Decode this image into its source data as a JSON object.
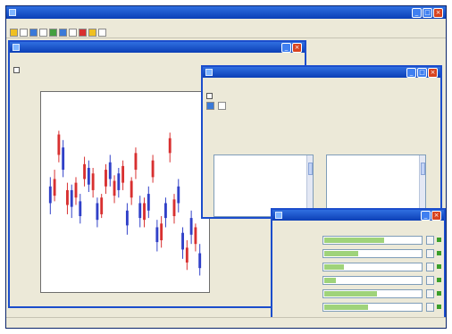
{
  "app": {
    "title": ""
  },
  "menu": {
    "items": [
      "",
      "",
      "",
      "",
      "",
      "",
      "",
      ""
    ]
  },
  "status": {
    "cells": [
      "",
      "",
      ""
    ]
  },
  "chart_window": {
    "title": "",
    "logo": "",
    "field_label": "",
    "option_label": ""
  },
  "chart_data": {
    "type": "candlestick",
    "grid": false,
    "bars": [
      {
        "o": 0.53,
        "c": 0.44,
        "h": 0.58,
        "l": 0.38
      },
      {
        "o": 0.48,
        "c": 0.57,
        "h": 0.62,
        "l": 0.45
      },
      {
        "o": 0.7,
        "c": 0.81,
        "h": 0.83,
        "l": 0.66
      },
      {
        "o": 0.74,
        "c": 0.62,
        "h": 0.78,
        "l": 0.58
      },
      {
        "o": 0.43,
        "c": 0.51,
        "h": 0.55,
        "l": 0.38
      },
      {
        "o": 0.51,
        "c": 0.42,
        "h": 0.54,
        "l": 0.36
      },
      {
        "o": 0.47,
        "c": 0.55,
        "h": 0.58,
        "l": 0.43
      },
      {
        "o": 0.45,
        "c": 0.37,
        "h": 0.49,
        "l": 0.33
      },
      {
        "o": 0.57,
        "c": 0.65,
        "h": 0.69,
        "l": 0.53
      },
      {
        "o": 0.63,
        "c": 0.54,
        "h": 0.67,
        "l": 0.5
      },
      {
        "o": 0.51,
        "c": 0.6,
        "h": 0.63,
        "l": 0.47
      },
      {
        "o": 0.44,
        "c": 0.35,
        "h": 0.47,
        "l": 0.31
      },
      {
        "o": 0.38,
        "c": 0.47,
        "h": 0.49,
        "l": 0.36
      },
      {
        "o": 0.53,
        "c": 0.62,
        "h": 0.65,
        "l": 0.49
      },
      {
        "o": 0.66,
        "c": 0.57,
        "h": 0.7,
        "l": 0.53
      },
      {
        "o": 0.48,
        "c": 0.56,
        "h": 0.59,
        "l": 0.44
      },
      {
        "o": 0.6,
        "c": 0.51,
        "h": 0.63,
        "l": 0.47
      },
      {
        "o": 0.55,
        "c": 0.64,
        "h": 0.67,
        "l": 0.51
      },
      {
        "o": 0.4,
        "c": 0.32,
        "h": 0.44,
        "l": 0.27
      },
      {
        "o": 0.47,
        "c": 0.56,
        "h": 0.58,
        "l": 0.43
      },
      {
        "o": 0.62,
        "c": 0.71,
        "h": 0.74,
        "l": 0.57
      },
      {
        "o": 0.44,
        "c": 0.36,
        "h": 0.48,
        "l": 0.31
      },
      {
        "o": 0.35,
        "c": 0.44,
        "h": 0.47,
        "l": 0.31
      },
      {
        "o": 0.49,
        "c": 0.4,
        "h": 0.53,
        "l": 0.36
      },
      {
        "o": 0.58,
        "c": 0.67,
        "h": 0.7,
        "l": 0.55
      },
      {
        "o": 0.31,
        "c": 0.23,
        "h": 0.35,
        "l": 0.18
      },
      {
        "o": 0.24,
        "c": 0.33,
        "h": 0.37,
        "l": 0.2
      },
      {
        "o": 0.44,
        "c": 0.36,
        "h": 0.47,
        "l": 0.31
      },
      {
        "o": 0.71,
        "c": 0.79,
        "h": 0.82,
        "l": 0.66
      },
      {
        "o": 0.37,
        "c": 0.46,
        "h": 0.49,
        "l": 0.33
      },
      {
        "o": 0.53,
        "c": 0.44,
        "h": 0.57,
        "l": 0.39
      },
      {
        "o": 0.28,
        "c": 0.19,
        "h": 0.31,
        "l": 0.14
      },
      {
        "o": 0.12,
        "c": 0.2,
        "h": 0.24,
        "l": 0.08
      },
      {
        "o": 0.36,
        "c": 0.27,
        "h": 0.4,
        "l": 0.22
      },
      {
        "o": 0.22,
        "c": 0.31,
        "h": 0.33,
        "l": 0.18
      },
      {
        "o": 0.17,
        "c": 0.09,
        "h": 0.22,
        "l": 0.05
      }
    ],
    "colors": {
      "up": "#d83030",
      "down": "#3040c8"
    }
  },
  "options_window": {
    "title": "",
    "logo": "",
    "header_rows": [
      "",
      "",
      ""
    ],
    "section_label": "",
    "group_label": "",
    "left_list": [
      "",
      "",
      "",
      "",
      "",
      "",
      ""
    ],
    "right_list": [
      "",
      "",
      "",
      "",
      "",
      "",
      ""
    ]
  },
  "props_window": {
    "title": "",
    "header": "",
    "rows": [
      {
        "label": "",
        "value": "",
        "fill": 0.62
      },
      {
        "label": "",
        "value": "",
        "fill": 0.35
      },
      {
        "label": "",
        "value": "",
        "fill": 0.2
      },
      {
        "label": "",
        "value": "",
        "fill": 0.12
      },
      {
        "label": "",
        "value": "",
        "fill": 0.55
      },
      {
        "label": "",
        "value": "",
        "fill": 0.45
      }
    ],
    "footer": ""
  },
  "colors": {
    "title_bar": "#0b3fb6",
    "logo": "#39a816",
    "window_bg": "#ece9d8"
  }
}
